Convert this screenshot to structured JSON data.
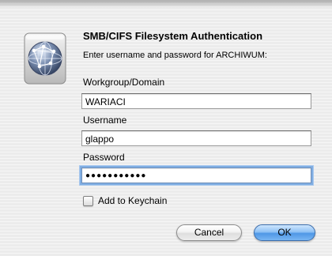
{
  "dialog": {
    "title": "SMB/CIFS Filesystem Authentication",
    "subtitle": "Enter username and password for ARCHIWUM:",
    "icon": "network-globe-icon"
  },
  "fields": {
    "workgroup": {
      "label": "Workgroup/Domain",
      "value": "WARIACI"
    },
    "username": {
      "label": "Username",
      "value": "glappo"
    },
    "password": {
      "label": "Password",
      "value": "●●●●●●●●●●●"
    }
  },
  "keychain": {
    "label": "Add to Keychain",
    "checked": false
  },
  "buttons": {
    "cancel_label": "Cancel",
    "ok_label": "OK"
  },
  "colors": {
    "window_bg": "#ececec",
    "focus_ring": "#80aee3",
    "default_button": "#4f97e6"
  }
}
